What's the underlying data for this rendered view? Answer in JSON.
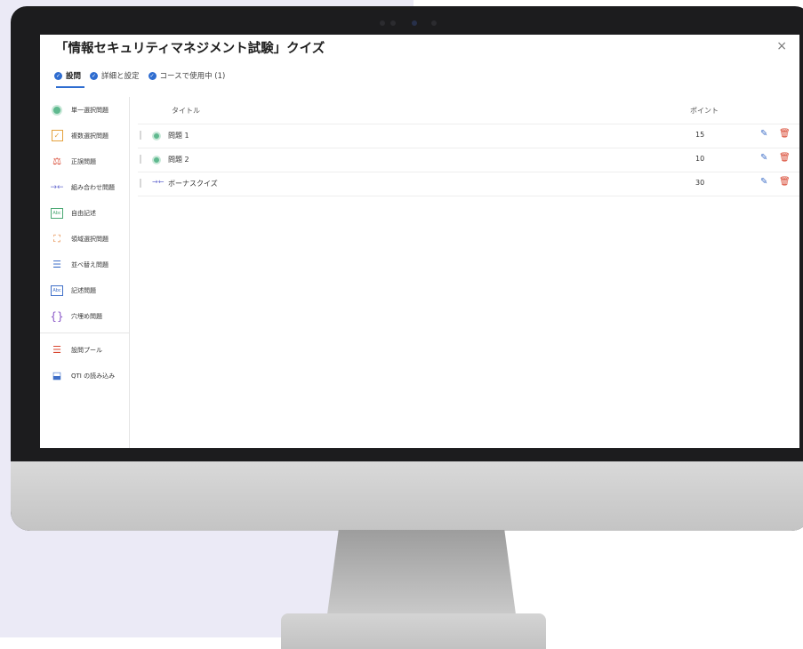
{
  "dialog": {
    "title": "「情報セキュリティマネジメント試験」クイズ",
    "close": "×"
  },
  "tabs": [
    {
      "label": "設問",
      "active": true
    },
    {
      "label": "詳細と設定",
      "active": false
    },
    {
      "label": "コースで使用中 (1)",
      "active": false
    }
  ],
  "sidebar": {
    "items": [
      {
        "label": "単一選択問題",
        "icon": "radio-icon"
      },
      {
        "label": "複数選択問題",
        "icon": "checkbox-icon"
      },
      {
        "label": "正誤問題",
        "icon": "scale-icon"
      },
      {
        "label": "組み合わせ問題",
        "icon": "matching-arrows-icon"
      },
      {
        "label": "自由記述",
        "icon": "essay-icon"
      },
      {
        "label": "領域選択問題",
        "icon": "hotspot-icon"
      },
      {
        "label": "並べ替え問題",
        "icon": "ordering-icon"
      },
      {
        "label": "記述問題",
        "icon": "short-answer-icon"
      },
      {
        "label": "穴埋め問題",
        "icon": "braces-icon"
      },
      {
        "label": "設問プール",
        "icon": "list-pool-icon"
      },
      {
        "label": "QTI の読み込み",
        "icon": "import-icon"
      }
    ]
  },
  "table": {
    "headers": {
      "title": "タイトル",
      "points": "ポイント"
    },
    "rows": [
      {
        "title": "問題 1",
        "points": "15",
        "type": "single-choice"
      },
      {
        "title": "問題 2",
        "points": "10",
        "type": "single-choice"
      },
      {
        "title": "ボーナスクイズ",
        "points": "30",
        "type": "matching"
      }
    ]
  },
  "colors": {
    "accent": "#2f6dd0",
    "green": "#5fb98f",
    "delete": "#d8452f",
    "background": "#ebeaf6"
  }
}
